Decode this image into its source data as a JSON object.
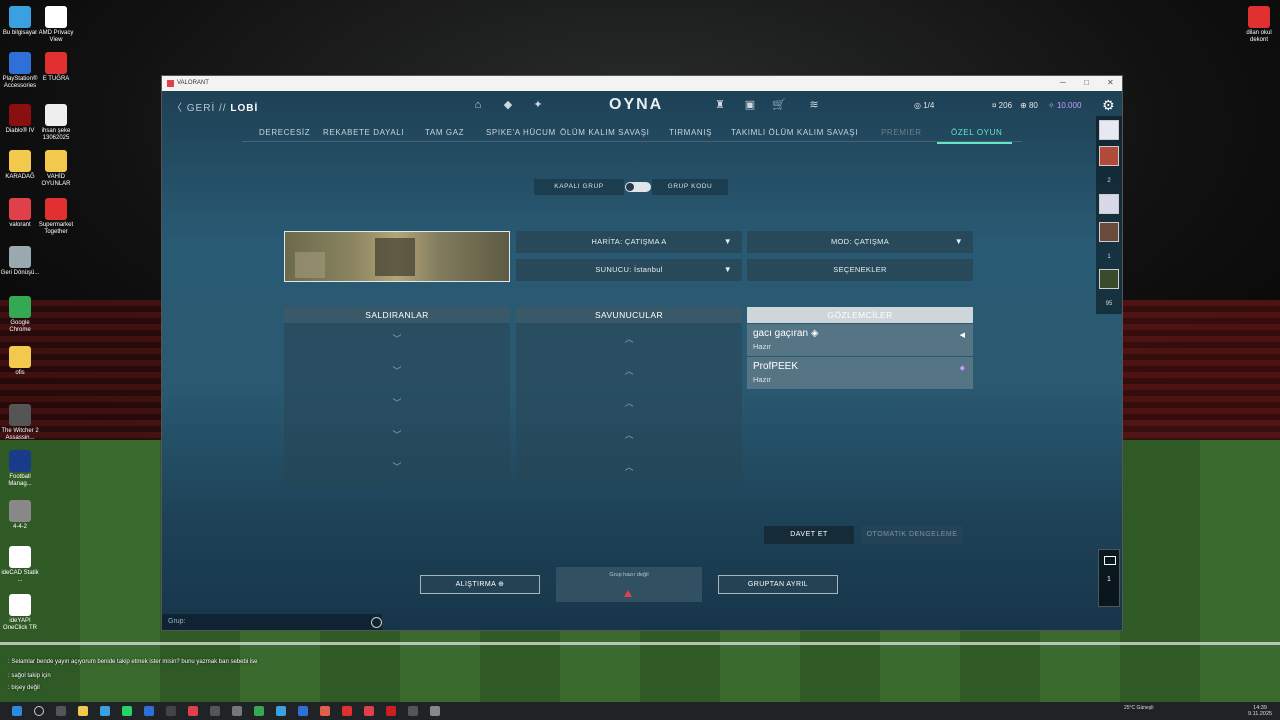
{
  "desktop": {
    "icons_left": [
      {
        "label": "Bu bilgisayar",
        "color": "#3aa0e0"
      },
      {
        "label": "AMD Privacy View",
        "color": "#ffffff"
      },
      {
        "label": "PlayStation® Accessories",
        "color": "#2e6fd8"
      },
      {
        "label": "E TUĞRA",
        "color": "#e03030"
      },
      {
        "label": "Diablo® IV",
        "color": "#8a1010"
      },
      {
        "label": "ihsan şeke 13062025",
        "color": "#eeeeee"
      },
      {
        "label": "KARADAĞ",
        "color": "#f2c94c"
      },
      {
        "label": "VAHİD OYUNLAR",
        "color": "#f2c94c"
      },
      {
        "label": "valorant",
        "color": "#e0404a"
      },
      {
        "label": "Supermarket Together",
        "color": "#e03030"
      },
      {
        "label": "Geri Dönüşü...",
        "color": "#9aa8b0"
      },
      {
        "label": "Google Chrome",
        "color": "#34a853"
      },
      {
        "label": "ofis",
        "color": "#f2c94c"
      },
      {
        "label": "The Witcher 2 Assassin...",
        "color": "#555555"
      },
      {
        "label": "Football Manag...",
        "color": "#1a3a8a"
      },
      {
        "label": "4-4-2",
        "color": "#888888"
      },
      {
        "label": "ideCAD Statik ...",
        "color": "#ffffff"
      },
      {
        "label": "ideYAPI OneClick TR",
        "color": "#ffffff"
      }
    ],
    "icon_right": {
      "label": "dilan okul dekont",
      "color": "#e03030"
    },
    "chat_overlay": [
      ": Selamlar bende yayın açıyorum benide takip etmek ister misin? bunu yazmak ban sebebi ise",
      ": sağol takip için",
      ": bişey değil"
    ]
  },
  "window": {
    "title": "VALORANT",
    "nav": {
      "back_label": "GERİ",
      "separator": "//",
      "page_label": "LOBİ",
      "play_label": "OYNA",
      "party_count": "1/4",
      "currency": {
        "radianite": "206",
        "kingdom": "80",
        "vp": "10.000"
      }
    },
    "modes": [
      {
        "label": "DERECESİZ",
        "state": "normal"
      },
      {
        "label": "REKABETE DAYALI",
        "state": "normal"
      },
      {
        "label": "TAM GAZ",
        "state": "normal"
      },
      {
        "label": "SPIKE'A HÜCUM",
        "state": "normal"
      },
      {
        "label": "ÖLÜM KALIM SAVAŞI",
        "state": "normal"
      },
      {
        "label": "TIRMANIŞ",
        "state": "normal"
      },
      {
        "label": "TAKIMLI ÖLÜM KALIM SAVAŞI",
        "state": "normal"
      },
      {
        "label": "PREMIER",
        "state": "dim"
      },
      {
        "label": "ÖZEL OYUN",
        "state": "active"
      }
    ],
    "group": {
      "closed_label": "KAPALI GRUP",
      "code_label": "GRUP KODU"
    },
    "settings": {
      "map_label": "HARİTA: ÇATIŞMA A",
      "mode_label": "MOD: ÇATIŞMA",
      "server_label": "SUNUCU: İstanbul",
      "options_label": "SEÇENEKLER"
    },
    "teams": {
      "attackers": {
        "title": "SALDIRANLAR",
        "slot_glyph": "﹀"
      },
      "defenders": {
        "title": "SAVUNUCULAR",
        "slot_glyph": "︿"
      },
      "observers": {
        "title": "GÖZLEMCİLER",
        "players": [
          {
            "name": "gacı gaçıran",
            "status": "Hazır",
            "marker": "◀"
          },
          {
            "name": "ProfPEEK",
            "status": "Hazır",
            "marker": "◆"
          }
        ]
      }
    },
    "actions": {
      "invite_label": "DAVET ET",
      "autobalance_label": "OTOMATİK DENGELEME",
      "practice_label": "ALIŞTIRMA",
      "leave_label": "GRUPTAN AYRIL",
      "ready_text": "Grup hazır değil"
    },
    "chat": {
      "placeholder": "Grup:"
    },
    "social": {
      "counts": [
        "2",
        "1",
        "95"
      ],
      "message_count": "1"
    }
  },
  "taskbar": {
    "weather": "25°C Güneşli",
    "time": "14:39",
    "date": "9.11.2025"
  },
  "colors": {
    "accent": "#64e6c4",
    "danger": "#e0404a",
    "vp": "#c89bff"
  }
}
